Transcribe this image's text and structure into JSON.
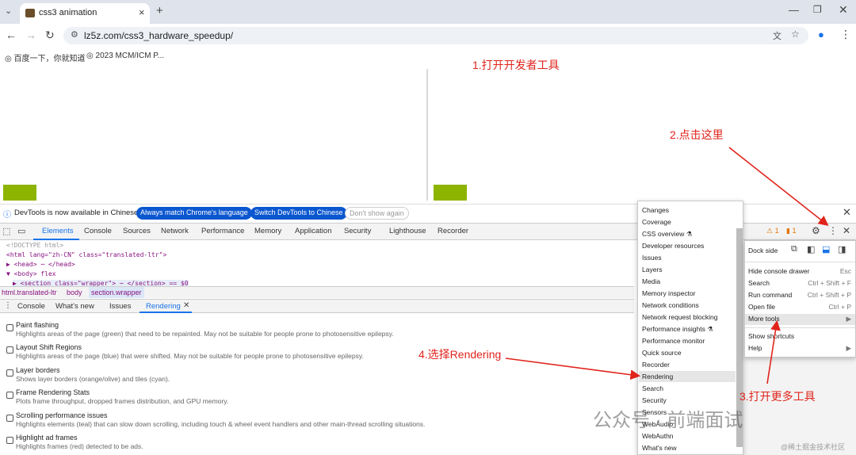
{
  "browser": {
    "tab_title": "css3 animation",
    "url": "lz5z.com/css3_hardware_speedup/",
    "bookmarks": [
      "百度一下，你就知道",
      "2023 MCM/ICM P..."
    ]
  },
  "notice": {
    "text": "DevTools is now available in Chinese!",
    "btn_match": "Always match Chrome's language",
    "btn_switch": "Switch DevTools to Chinese",
    "btn_dismiss": "Don't show again"
  },
  "devtools": {
    "tabs": [
      "Elements",
      "Console",
      "Sources",
      "Network",
      "Performance",
      "Memory",
      "Application",
      "Security",
      "Lighthouse",
      "Recorder"
    ],
    "warn_count": "1",
    "issue_count": "1",
    "tree": [
      "<!DOCTYPE html>",
      "<html lang=\"zh-CN\" class=\"translated-ltr\">",
      "▶ <head> ⋯ </head>",
      "▼ <body> flex",
      "▶ <section class=\"wrapper\"> ⋯ </section> == $0"
    ],
    "breadcrumb": [
      "html.translated-ltr",
      "body",
      "section.wrapper"
    ],
    "drawer_tabs": [
      "Console",
      "What's new",
      "Issues",
      "Rendering"
    ]
  },
  "rendering_options": [
    {
      "title": "Paint flashing",
      "desc": "Highlights areas of the page (green) that need to be repainted. May not be suitable for people prone to photosensitive epilepsy."
    },
    {
      "title": "Layout Shift Regions",
      "desc": "Highlights areas of the page (blue) that were shifted. May not be suitable for people prone to photosensitive epilepsy."
    },
    {
      "title": "Layer borders",
      "desc": "Shows layer borders (orange/olive) and tiles (cyan)."
    },
    {
      "title": "Frame Rendering Stats",
      "desc": "Plots frame throughput, dropped frames distribution, and GPU memory."
    },
    {
      "title": "Scrolling performance issues",
      "desc": "Highlights elements (teal) that can slow down scrolling, including touch & wheel event handlers and other main-thread scrolling situations."
    },
    {
      "title": "Highlight ad frames",
      "desc": "Highlights frames (red) detected to be ads."
    }
  ],
  "more_tools": [
    "Changes",
    "Coverage",
    "CSS overview ⚗",
    "Developer resources",
    "Issues",
    "Layers",
    "Media",
    "Memory inspector",
    "Network conditions",
    "Network request blocking",
    "Performance insights ⚗",
    "Performance monitor",
    "Quick source",
    "Recorder",
    "Rendering",
    "Search",
    "Security",
    "Sensors",
    "WebAudio",
    "WebAuthn",
    "What's new"
  ],
  "main_menu": {
    "dock_side": "Dock side",
    "items": [
      {
        "label": "Hide console drawer",
        "key": "Esc"
      },
      {
        "label": "Search",
        "key": "Ctrl + Shift + F"
      },
      {
        "label": "Run command",
        "key": "Ctrl + Shift + P"
      },
      {
        "label": "Open file",
        "key": "Ctrl + P"
      },
      {
        "label": "More tools",
        "key": "▶"
      },
      {
        "label": "Show shortcuts",
        "key": ""
      },
      {
        "label": "Help",
        "key": "▶"
      }
    ]
  },
  "annotations": [
    "1.打开开发者工具",
    "2.点击这里",
    "3.打开更多工具",
    "4.选择Rendering"
  ],
  "watermark": "公众号 · 前端面试",
  "watermark_small": "@稀土掘金技术社区",
  "colors": {
    "annotation": "#e0241c",
    "accent": "#1a73e8",
    "green_box": "#8db400"
  }
}
